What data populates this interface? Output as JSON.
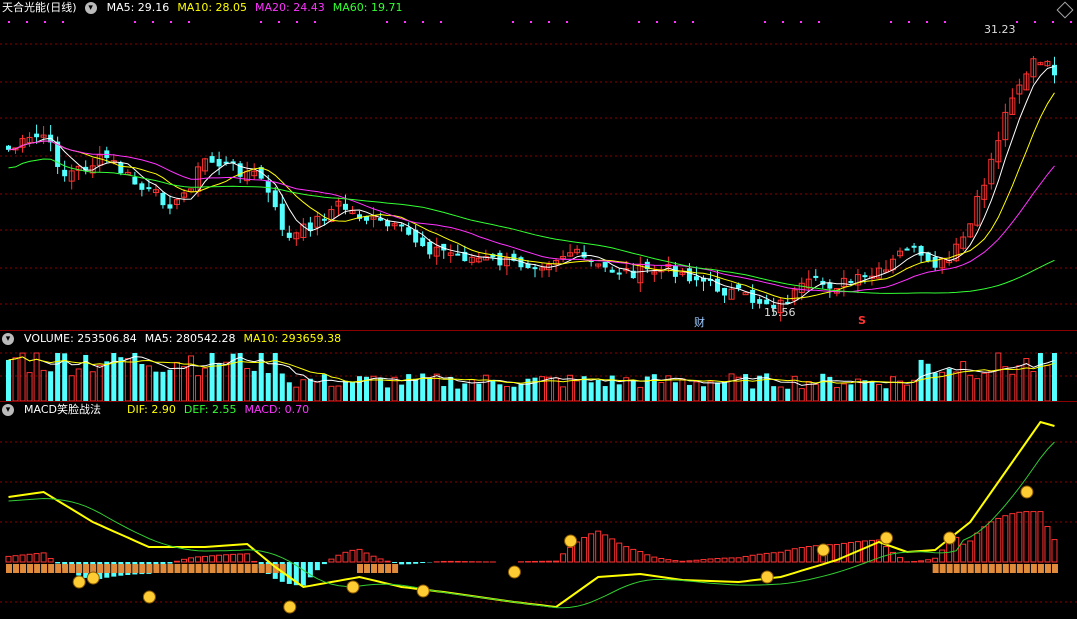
{
  "price_panel": {
    "stock_name": "天合光能(日线)",
    "indicators": [
      {
        "label": "MA5: 29.16",
        "color": "#ffffff"
      },
      {
        "label": "MA10: 28.05",
        "color": "#ffff00"
      },
      {
        "label": "MA20: 24.43",
        "color": "#ff33ff"
      },
      {
        "label": "MA60: 19.71",
        "color": "#33ff33"
      }
    ],
    "high_label": "31.23",
    "low_label": "15.56",
    "event_mark_finance": "财",
    "event_mark_s": "S"
  },
  "volume_panel": {
    "title": "VOLUME: 253506.84",
    "indicators": [
      {
        "label": "MA5: 280542.28",
        "color": "#ffffff"
      },
      {
        "label": "MA10: 293659.38",
        "color": "#ffff00"
      }
    ]
  },
  "macd_panel": {
    "title": "MACD笑脸战法",
    "indicators": [
      {
        "label": "DIF: 2.90",
        "color": "#ffff00"
      },
      {
        "label": "DEF: 2.55",
        "color": "#33ff33"
      },
      {
        "label": "MACD: 0.70",
        "color": "#ff33ff"
      }
    ]
  },
  "colors": {
    "up": "#ff3232",
    "down": "#54ffff",
    "grid": "#8b0000"
  }
}
